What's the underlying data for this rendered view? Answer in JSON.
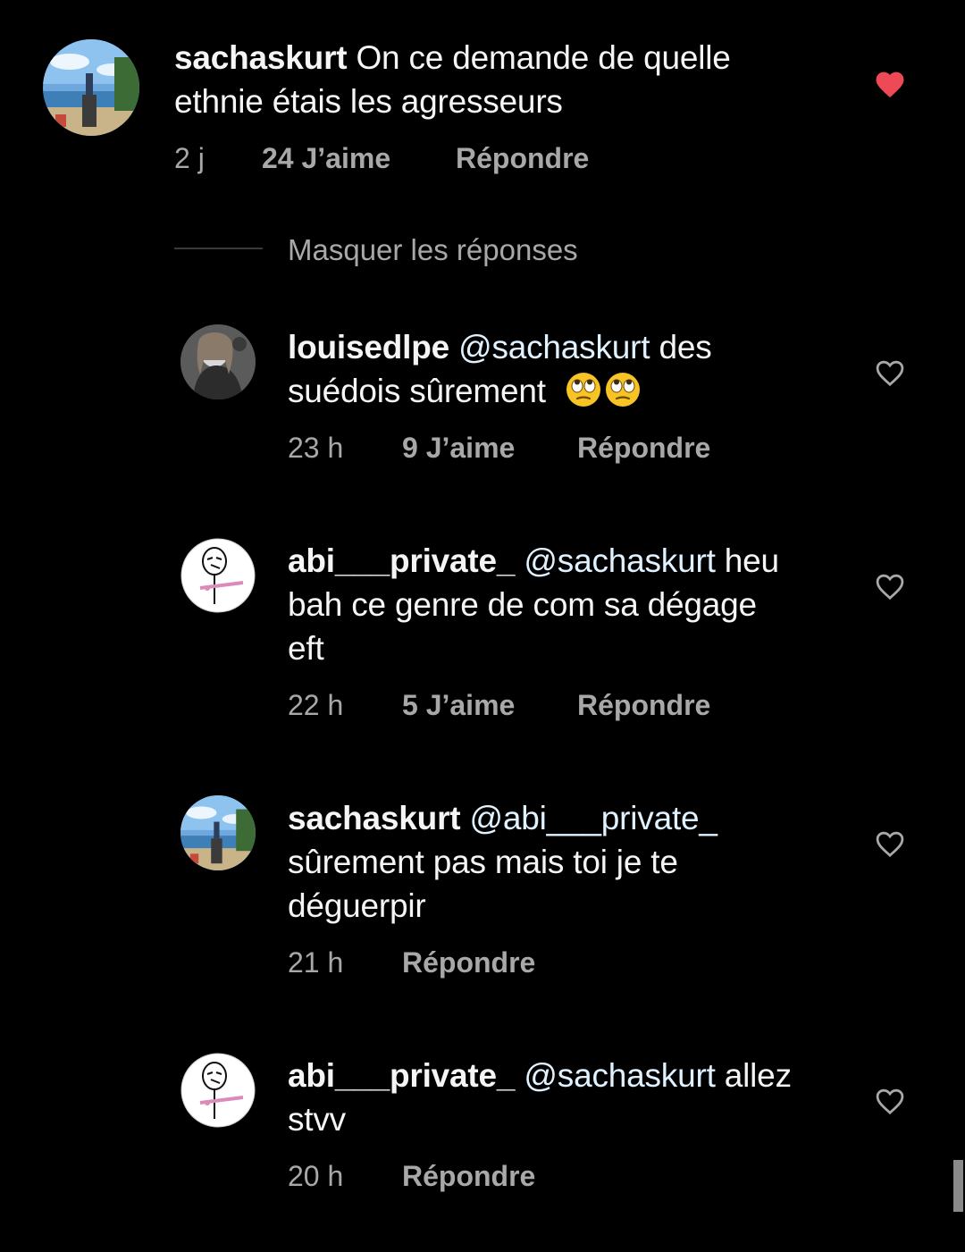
{
  "comments": [
    {
      "username": "sachaskurt",
      "mention": "",
      "text_line1": " On ce demande de quelle",
      "text_line2": "ethnie étais les agresseurs",
      "text_line3": "",
      "time": "2 j",
      "likes": "24 J’aime",
      "reply": "Répondre",
      "liked": true
    },
    {
      "username": "louisedlpe",
      "mention": "@sachaskurt",
      "text_line1": " des",
      "text_line2": "suédois sûrement",
      "text_line3": "",
      "emojis": [
        "face-with-rolling-eyes",
        "face-with-rolling-eyes"
      ],
      "time": "23 h",
      "likes": "9 J’aime",
      "reply": "Répondre",
      "liked": false
    },
    {
      "username": "abi___private_",
      "mention": "@sachaskurt",
      "text_line1": " heu",
      "text_line2": "bah ce genre de com sa dégage",
      "text_line3": "eft",
      "time": "22 h",
      "likes": "5 J’aime",
      "reply": "Répondre",
      "liked": false
    },
    {
      "username": "sachaskurt",
      "mention": "@abi___private_",
      "text_line1": "",
      "text_line2": "sûrement pas mais toi je te",
      "text_line3": "déguerpir",
      "time": "21 h",
      "likes": "",
      "reply": "Répondre",
      "liked": false
    },
    {
      "username": "abi___private_",
      "mention": "@sachaskurt",
      "text_line1": " allez",
      "text_line2": "stvv",
      "text_line3": "",
      "time": "20 h",
      "likes": "",
      "reply": "Répondre",
      "liked": false
    }
  ],
  "hide_replies_label": "Masquer les réponses",
  "colors": {
    "background": "#000000",
    "text": "#f5f5f5",
    "meta": "#a8a8a8",
    "liked_heart": "#ed4956",
    "mention": "#e0f1ff"
  },
  "icons": {
    "liked": "heart-filled-icon",
    "unliked": "heart-outline-icon"
  }
}
